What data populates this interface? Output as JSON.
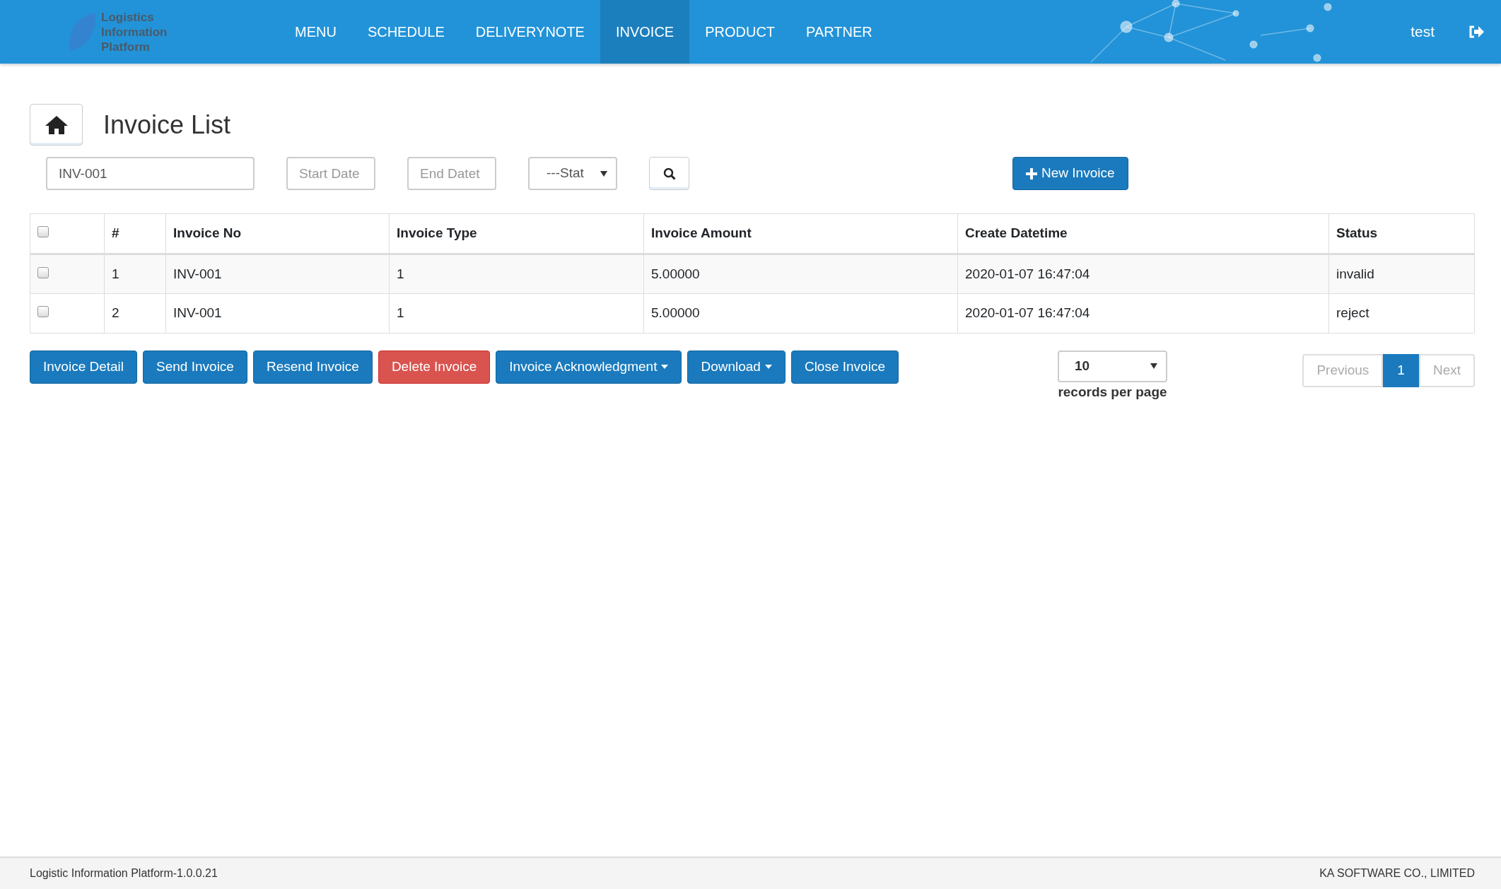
{
  "navbar": {
    "logo_lines": [
      "Logistics",
      "Information",
      "Platform"
    ],
    "items": [
      {
        "label": "MENU",
        "selected": false
      },
      {
        "label": "SCHEDULE",
        "selected": false
      },
      {
        "label": "DELIVERYNOTE",
        "selected": false
      },
      {
        "label": "INVOICE",
        "selected": true
      },
      {
        "label": "PRODUCT",
        "selected": false
      },
      {
        "label": "PARTNER",
        "selected": false
      }
    ],
    "user": "test"
  },
  "page": {
    "title": "Invoice List"
  },
  "filters": {
    "invoice_no": {
      "value": "INV-001"
    },
    "start_date": {
      "placeholder": "Start Date"
    },
    "end_date": {
      "placeholder": "End Datet"
    },
    "status": {
      "value": "---Stat"
    },
    "new_button": "New Invoice"
  },
  "table": {
    "header_checked": false,
    "columns": [
      "#",
      "Invoice No",
      "Invoice Type",
      "Invoice Amount",
      "Create Datetime",
      "Status"
    ],
    "rows": [
      {
        "checked": false,
        "cells": [
          "1",
          "INV-001",
          "1",
          "5.00000",
          "2020-01-07 16:47:04",
          "invalid"
        ]
      },
      {
        "checked": false,
        "cells": [
          "2",
          "INV-001",
          "1",
          "5.00000",
          "2020-01-07 16:47:04",
          "reject"
        ]
      }
    ]
  },
  "actions": [
    {
      "label": "Invoice Detail",
      "kind": "primary"
    },
    {
      "label": "Send Invoice",
      "kind": "primary"
    },
    {
      "label": "Resend Invoice",
      "kind": "primary"
    },
    {
      "label": "Delete Invoice",
      "kind": "danger"
    },
    {
      "label": "Invoice Acknowledgment",
      "kind": "dropdown"
    },
    {
      "label": "Download",
      "kind": "dropdown"
    },
    {
      "label": "Close Invoice",
      "kind": "primary"
    }
  ],
  "page_size": {
    "value": "10",
    "label": "records per page"
  },
  "pagination": [
    {
      "label": "Previous",
      "selected": false,
      "disabled": true
    },
    {
      "label": "1",
      "selected": true,
      "disabled": false
    },
    {
      "label": "Next",
      "selected": false,
      "disabled": true
    }
  ],
  "footer": {
    "left": "Logistic Information Platform-1.0.0.21",
    "right": "KA SOFTWARE CO., LIMITED"
  }
}
